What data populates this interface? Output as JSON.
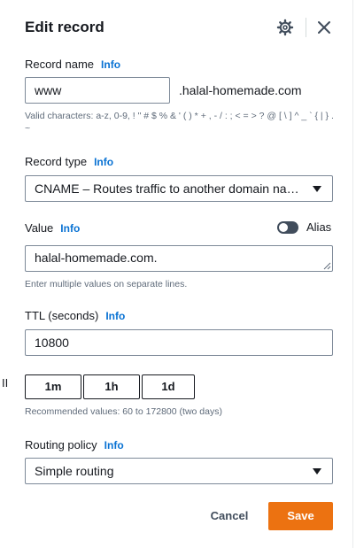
{
  "header": {
    "title": "Edit record",
    "settings_icon": "gear-icon",
    "close_icon": "close-icon"
  },
  "info_label": "Info",
  "record_name": {
    "label": "Record name",
    "value": "www",
    "suffix": ".halal-homemade.com",
    "hint": "Valid characters: a-z, 0-9, ! \" # $ % & ' ( ) * + , - / : ; < = > ? @ [ \\ ] ^ _ ` { | } . ~"
  },
  "record_type": {
    "label": "Record type",
    "selected": "CNAME – Routes traffic to another domain name and to some AWS resources"
  },
  "value": {
    "label": "Value",
    "text": "halal-homemade.com.",
    "hint": "Enter multiple values on separate lines.",
    "alias_label": "Alias",
    "alias_enabled": false
  },
  "ttl": {
    "label": "TTL (seconds)",
    "value": "10800",
    "presets": [
      "1m",
      "1h",
      "1d"
    ],
    "hint": "Recommended values: 60 to 172800 (two days)"
  },
  "routing_policy": {
    "label": "Routing policy",
    "selected": "Simple routing"
  },
  "footer": {
    "cancel_label": "Cancel",
    "save_label": "Save",
    "save_color": "#ec7211"
  },
  "left_marker": "II"
}
